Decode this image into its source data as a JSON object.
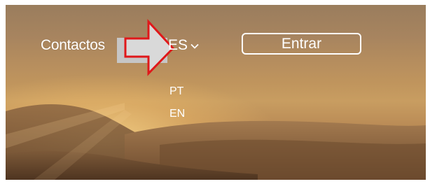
{
  "nav": {
    "contacts_label": "Contactos",
    "language": {
      "current": "ES",
      "options": [
        "PT",
        "EN"
      ]
    },
    "login_label": "Entrar"
  },
  "annotation": {
    "arrow_color": "#e0181a",
    "highlight_box_color": "#c6c6c6"
  },
  "icons": {
    "dropdown": "chevron-down-icon",
    "pointer": "arrow-right-icon"
  }
}
